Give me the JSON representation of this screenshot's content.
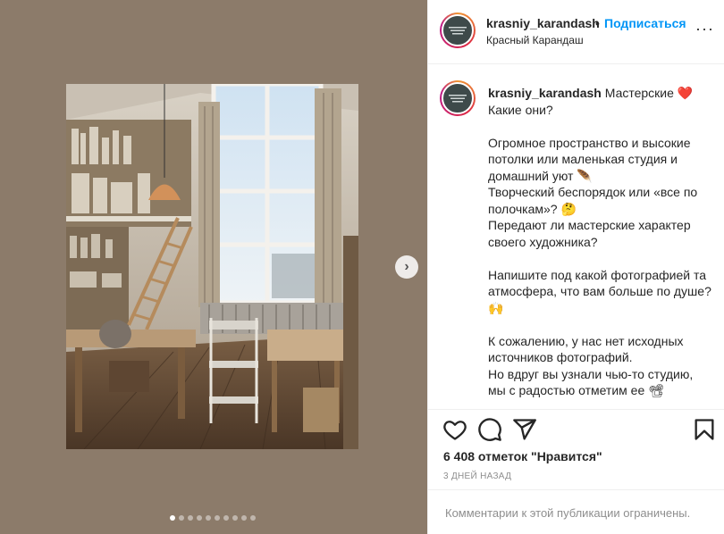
{
  "colors": {
    "media_bg": "#8c7b6a",
    "link": "#0095f6",
    "muted": "#8e8e8e",
    "heart": "#e0243a"
  },
  "carousel": {
    "total_slides": 10,
    "active_index": 0,
    "next_icon": "chevron-right-icon",
    "next_glyph": "›"
  },
  "header": {
    "username": "krasniy_karandash",
    "separator": "•",
    "follow_label": "Подписаться",
    "subtitle": "Красный Карандаш",
    "more_glyph": "···"
  },
  "caption": {
    "username": "krasniy_karandash",
    "text": "Мастерские ❤️\nКакие они?\n\nОгромное пространство и высокие потолки или маленькая студия и домашний уют 🪶\nТворческий беспорядок или «все по полочкам»? 🤔\nПередают ли мастерские характер своего художника?\n\nНапишите под какой фотографией та атмосфера, что вам больше по душе? 🙌\n\nК сожалению, у нас нет исходных источников фотографий.\nНо вдруг вы узнали чью-то студию, мы с радостью отметим ее 📽"
  },
  "actions": {
    "like_icon": "heart-outline-icon",
    "comment_icon": "comment-icon",
    "share_icon": "share-icon",
    "save_icon": "bookmark-icon"
  },
  "likes_text": "6 408 отметок \"Нравится\"",
  "timestamp": "3 ДНЕЙ НАЗАД",
  "comments_notice": "Комментарии к этой публикации ограничены."
}
